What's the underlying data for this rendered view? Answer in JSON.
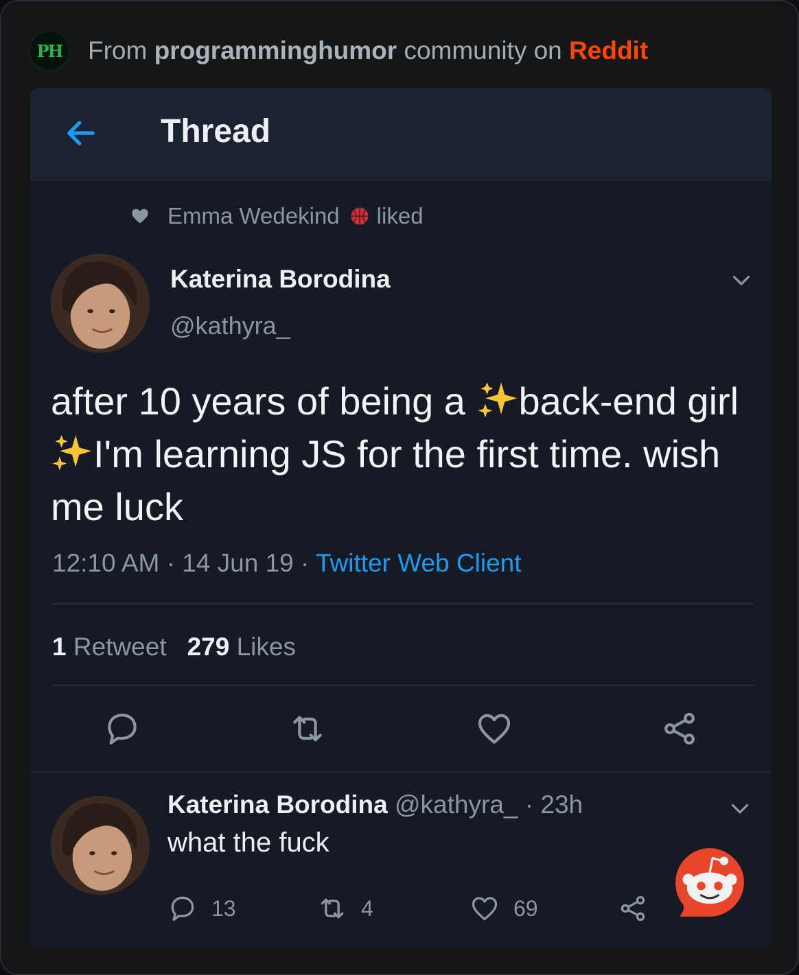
{
  "header": {
    "logo_text": "PH",
    "prefix": "From ",
    "community": "programminghumor",
    "middle": " community on ",
    "site": "Reddit"
  },
  "thread": {
    "title": "Thread"
  },
  "liked": {
    "user": "Emma Wedekind",
    "suffix": "liked"
  },
  "tweet": {
    "author": "Katerina Borodina",
    "handle": "@kathyra_",
    "text_1": "after 10 years of being a ",
    "text_2": "back-end girl",
    "text_3": "I'm learning JS for the first time. wish me luck",
    "time": "12:10 AM",
    "date": "14 Jun 19",
    "client": "Twitter Web Client",
    "retweet_count": "1",
    "retweet_label": "Retweet",
    "like_count": "279",
    "like_label": "Likes"
  },
  "reply": {
    "author": "Katerina Borodina",
    "handle": "@kathyra_",
    "age": "23h",
    "text": "what the fuck",
    "replies": "13",
    "retweets": "4",
    "likes": "69"
  },
  "colors": {
    "accent": "#1d9bf0",
    "reddit": "#ff4500",
    "background": "#161a24"
  },
  "icons": [
    "back-arrow-icon",
    "heart-icon",
    "basketball-icon",
    "chevron-down-icon",
    "sparkles-icon",
    "reply-icon",
    "retweet-icon",
    "share-icon",
    "reddit-snoo-icon"
  ]
}
